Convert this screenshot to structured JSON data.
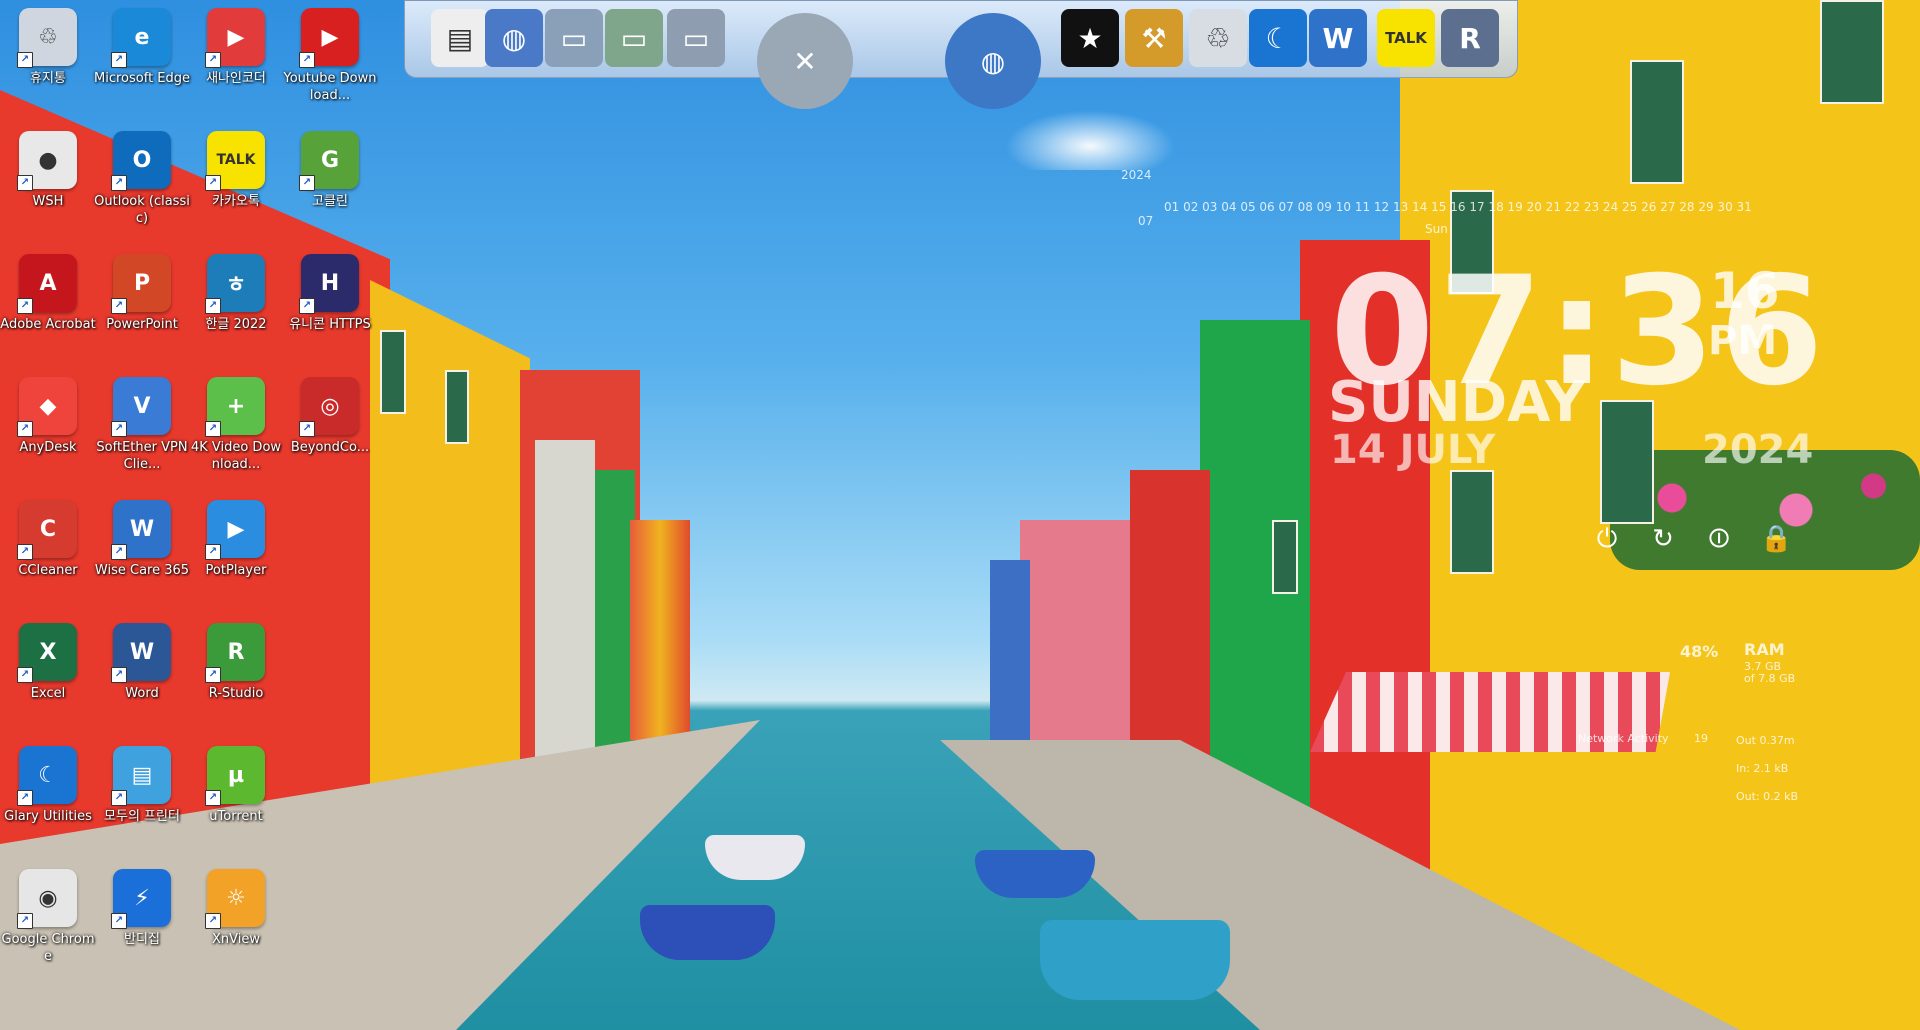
{
  "desktop_icons": [
    {
      "label": "휴지통",
      "color": "#cfd6df",
      "glyph": "♲",
      "icon": "recycle-bin-icon"
    },
    {
      "label": "Microsoft Edge",
      "color": "#1a8ad8",
      "glyph": "e",
      "icon": "edge-icon"
    },
    {
      "label": "새나인코더",
      "color": "#e23b3b",
      "glyph": "▶",
      "icon": "encoder-icon"
    },
    {
      "label": "Youtube Download...",
      "color": "#d92020",
      "glyph": "▶",
      "icon": "youtube-downloader-icon"
    },
    {
      "label": "WSH",
      "color": "#e8e8e8",
      "glyph": "●",
      "icon": "wsh-icon"
    },
    {
      "label": "Outlook (classic)",
      "color": "#0f6cbd",
      "glyph": "O",
      "icon": "outlook-icon"
    },
    {
      "label": "카카오톡",
      "color": "#f7e200",
      "glyph": "TALK",
      "icon": "kakaotalk-icon"
    },
    {
      "label": "고클린",
      "color": "#57a33a",
      "glyph": "G",
      "icon": "goclean-icon"
    },
    {
      "label": "Adobe Acrobat",
      "color": "#c4161c",
      "glyph": "A",
      "icon": "acrobat-icon"
    },
    {
      "label": "PowerPoint",
      "color": "#d24726",
      "glyph": "P",
      "icon": "powerpoint-icon"
    },
    {
      "label": "한글 2022",
      "color": "#1c7db8",
      "glyph": "ㅎ",
      "icon": "hangul-icon"
    },
    {
      "label": "유니콘 HTTPS",
      "color": "#2b2b6b",
      "glyph": "H",
      "icon": "unicorn-https-icon"
    },
    {
      "label": "AnyDesk",
      "color": "#ef443b",
      "glyph": "◆",
      "icon": "anydesk-icon"
    },
    {
      "label": "SoftEther VPN Clie...",
      "color": "#3a7bd5",
      "glyph": "V",
      "icon": "softether-icon"
    },
    {
      "label": "4K Video Download...",
      "color": "#5cbf4a",
      "glyph": "+",
      "icon": "4k-video-icon"
    },
    {
      "label": "BeyondCo...",
      "color": "#c92b2b",
      "glyph": "◎",
      "icon": "beyondcompare-icon"
    },
    {
      "label": "CCleaner",
      "color": "#d63b2f",
      "glyph": "C",
      "icon": "ccleaner-icon"
    },
    {
      "label": "Wise Care 365",
      "color": "#2f72c9",
      "glyph": "W",
      "icon": "wisecare-icon"
    },
    {
      "label": "PotPlayer",
      "color": "#2a8de0",
      "glyph": "▶",
      "icon": "potplayer-icon"
    },
    {
      "label": "",
      "color": "",
      "glyph": "",
      "icon": ""
    },
    {
      "label": "Excel",
      "color": "#1d7044",
      "glyph": "X",
      "icon": "excel-icon"
    },
    {
      "label": "Word",
      "color": "#2b5797",
      "glyph": "W",
      "icon": "word-icon"
    },
    {
      "label": "R-Studio",
      "color": "#3b9a3a",
      "glyph": "R",
      "icon": "rstudio-icon"
    },
    {
      "label": "",
      "color": "",
      "glyph": "",
      "icon": ""
    },
    {
      "label": "Glary Utilities",
      "color": "#1a75d2",
      "glyph": "☾",
      "icon": "glary-icon"
    },
    {
      "label": "모두의 프린터",
      "color": "#3fa2de",
      "glyph": "▤",
      "icon": "printer-icon"
    },
    {
      "label": "uTorrent",
      "color": "#5cb82e",
      "glyph": "µ",
      "icon": "utorrent-icon"
    },
    {
      "label": "",
      "color": "",
      "glyph": "",
      "icon": ""
    },
    {
      "label": "Google Chrome",
      "color": "#e6e6e6",
      "glyph": "◉",
      "icon": "chrome-icon"
    },
    {
      "label": "반디집",
      "color": "#1b6fd8",
      "glyph": "⚡",
      "icon": "bandizip-icon"
    },
    {
      "label": "XnView",
      "color": "#f2a227",
      "glyph": "☼",
      "icon": "xnview-icon"
    }
  ],
  "dock": [
    {
      "icon": "document-icon",
      "glyph": "▤",
      "color": "#eeeeee"
    },
    {
      "icon": "network-globe-icon",
      "glyph": "◍",
      "color": "#4a79c8"
    },
    {
      "icon": "folder-icon",
      "glyph": "▭",
      "color": "#8aa0b8"
    },
    {
      "icon": "folder-green-icon",
      "glyph": "▭",
      "color": "#7fa58a"
    },
    {
      "icon": "open-folder-icon",
      "glyph": "▭",
      "color": "#8e9eb0"
    },
    {
      "icon": "tools-icon",
      "glyph": "✕",
      "color": "#9aa7b5"
    },
    {
      "icon": "globe-icon",
      "glyph": "◍",
      "color": "#3d78c6"
    },
    {
      "icon": "tshirt-icon",
      "glyph": "★",
      "color": "#111111"
    },
    {
      "icon": "hammer-icon",
      "glyph": "⚒",
      "color": "#d49a2a"
    },
    {
      "icon": "trash-icon",
      "glyph": "♲",
      "color": "#d8dde4"
    },
    {
      "icon": "glary-moon-icon",
      "glyph": "☾",
      "color": "#1a75d2"
    },
    {
      "icon": "wise-shield-icon",
      "glyph": "W",
      "color": "#2f72c9"
    },
    {
      "icon": "talk-icon",
      "glyph": "TALK",
      "color": "#f7e200"
    },
    {
      "icon": "recovery-icon",
      "glyph": "R",
      "color": "#5d6f8f"
    }
  ],
  "widget": {
    "year_small": "2024",
    "month_small": "07",
    "days": "01 02 03 04 05 06 07 08 09 10 11 12 13 14 15 16 17 18 19 20 21 22 23 24 25 26 27 28 29 30 31",
    "weekday_small": "Sun",
    "time": "07:36",
    "seconds": "16",
    "ampm": "PM",
    "day": "SUNDAY",
    "date": "14 JULY",
    "year": "2024"
  },
  "system": {
    "cpu_percent": "48%",
    "ram_label": "RAM",
    "ram_used": "3.7 GB",
    "ram_total": "of 7.8 GB",
    "network_label": "Network Activity",
    "net_out_total": "Out 0.37m",
    "net_in": "In: 2.1 kB",
    "net_out": "Out: 0.2 kB",
    "net_count": "19"
  },
  "colors": {
    "sky": "#4aa6e8",
    "red_building": "#e8392d",
    "yellow_building": "#f5c419",
    "green_building": "#1fa54a",
    "water": "#2496a8"
  }
}
